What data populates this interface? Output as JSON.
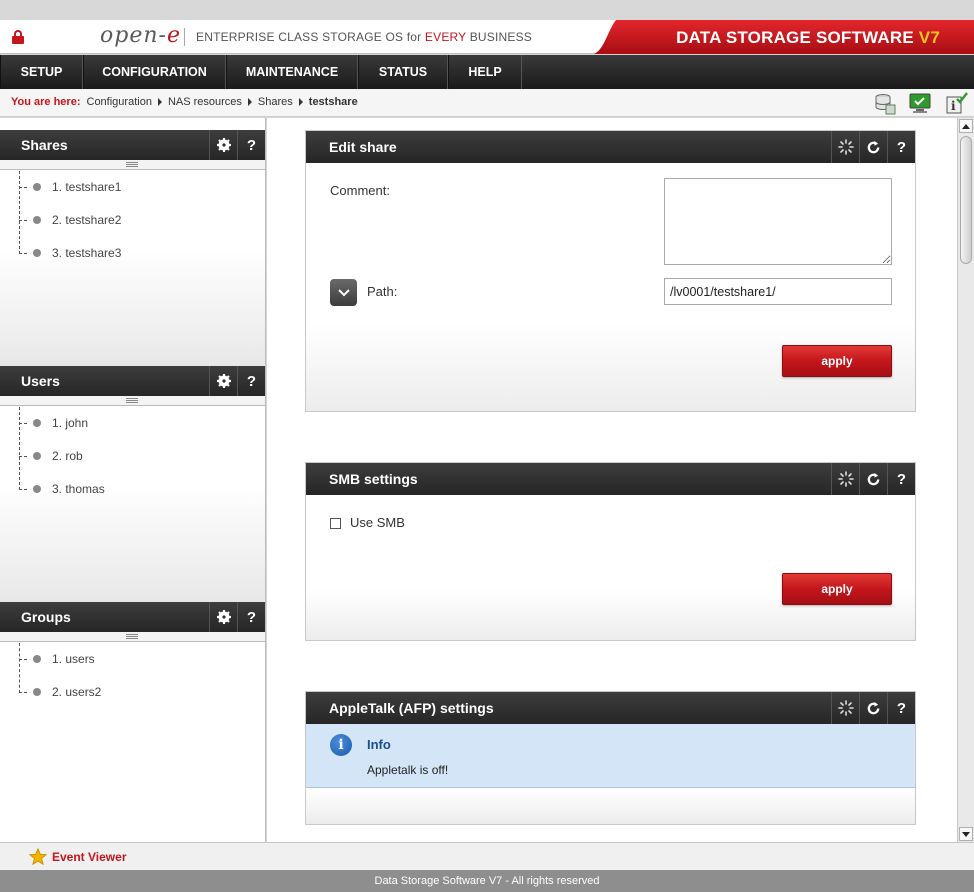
{
  "header": {
    "logo_text": "open-e",
    "tagline_pre": "ENTERPRISE CLASS STORAGE OS for ",
    "tagline_accent": "EVERY",
    "tagline_post": " BUSINESS",
    "product_name": "DATA STORAGE SOFTWARE ",
    "product_version": "V7",
    "accent_color": "#c4161c"
  },
  "nav": {
    "items": [
      {
        "label": "SETUP"
      },
      {
        "label": "CONFIGURATION"
      },
      {
        "label": "MAINTENANCE"
      },
      {
        "label": "STATUS"
      },
      {
        "label": "HELP"
      }
    ]
  },
  "breadcrumb": {
    "prefix": "You are here:",
    "items": [
      "Configuration",
      "NAS resources",
      "Shares"
    ],
    "current": "testshare"
  },
  "toolbar_icons": [
    "database-icon",
    "monitor-check-icon",
    "info-check-icon"
  ],
  "sidebar": {
    "shares": {
      "title": "Shares",
      "items": [
        "1. testshare1",
        "2. testshare2",
        "3. testshare3"
      ]
    },
    "users": {
      "title": "Users",
      "items": [
        "1. john",
        "2. rob",
        "3. thomas"
      ]
    },
    "groups": {
      "title": "Groups",
      "items": [
        "1. users",
        "2. users2"
      ]
    },
    "tool_gear": "gear-icon",
    "tool_help": "?"
  },
  "main": {
    "edit_share": {
      "title": "Edit share",
      "comment_label": "Comment:",
      "comment_value": "",
      "path_label": "Path:",
      "path_value": "/lv0001/testshare1/",
      "apply_label": "apply"
    },
    "smb": {
      "title": "SMB settings",
      "use_smb_label": "Use SMB",
      "use_smb_checked": false,
      "apply_label": "apply"
    },
    "afp": {
      "title": "AppleTalk (AFP) settings",
      "info_title": "Info",
      "info_text": "Appletalk is off!"
    },
    "tool_help": "?"
  },
  "event_viewer": {
    "label": "Event Viewer"
  },
  "footer": {
    "text": "Data Storage Software V7 - All rights reserved"
  }
}
